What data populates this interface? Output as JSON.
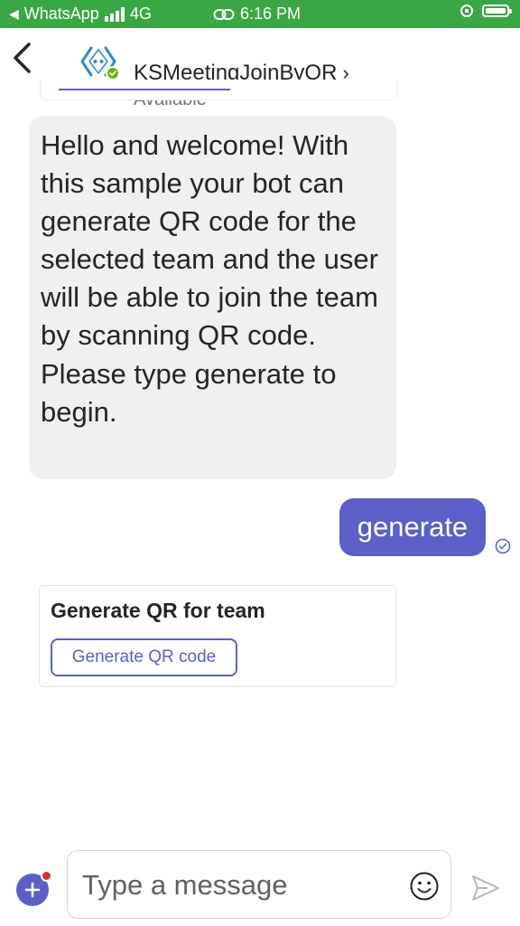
{
  "status_bar": {
    "back_app": "WhatsApp",
    "network": "4G",
    "time": "6:16 PM"
  },
  "header": {
    "title": "KSMeetingJoinByQR",
    "chevron": "›",
    "status": "Available",
    "presence_color": "#6bb700"
  },
  "messages": {
    "incoming": "Hello and welcome! With this sample your bot can generate QR code for the selected team and the user will be able to join the team by scanning QR code. Please type generate to begin.",
    "outgoing": "generate"
  },
  "card": {
    "title": "Generate QR for team",
    "button_label": "Generate QR code"
  },
  "compose": {
    "placeholder": "Type a message"
  },
  "colors": {
    "accent": "#5b5fc7",
    "status_bar": "#3aa745"
  },
  "icons": [
    "back-arrow-icon",
    "bot-icon",
    "check-icon",
    "read-receipt-icon",
    "plus-icon",
    "emoji-icon",
    "send-icon"
  ]
}
